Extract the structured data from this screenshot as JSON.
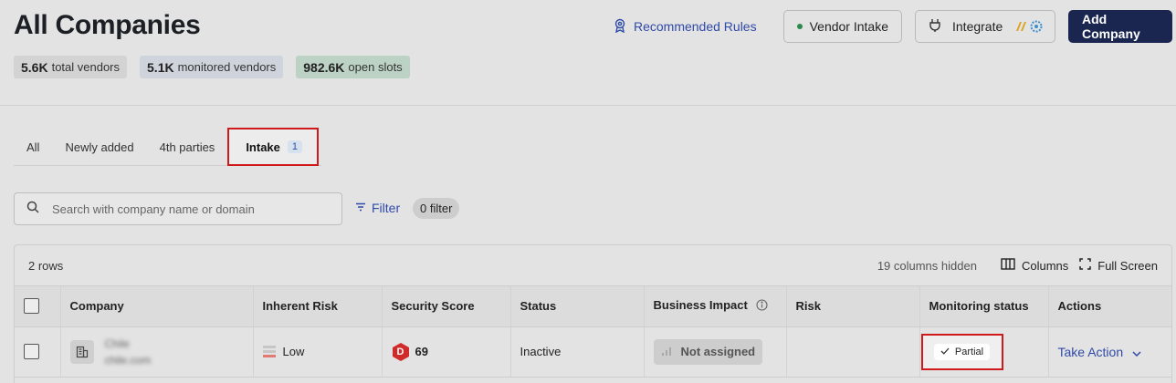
{
  "header": {
    "title": "All Companies",
    "recommended_rules": "Recommended Rules",
    "vendor_intake": "Vendor Intake",
    "integrate": "Integrate",
    "add_company": "Add Company"
  },
  "stats": {
    "total_value": "5.6K",
    "total_label": "total vendors",
    "monitored_value": "5.1K",
    "monitored_label": "monitored vendors",
    "slots_value": "982.6K",
    "slots_label": "open slots"
  },
  "tabs": [
    {
      "label": "All"
    },
    {
      "label": "Newly added"
    },
    {
      "label": "4th parties"
    },
    {
      "label": "Intake",
      "count": "1"
    }
  ],
  "search": {
    "placeholder": "Search with company name or domain"
  },
  "filter": {
    "label": "Filter",
    "count_label": "0 filter"
  },
  "table": {
    "row_count": "2 rows",
    "hidden_columns": "19 columns hidden",
    "columns_button": "Columns",
    "fullscreen_button": "Full Screen",
    "headers": {
      "company": "Company",
      "inherent_risk": "Inherent Risk",
      "security_score": "Security Score",
      "status": "Status",
      "business_impact": "Business Impact",
      "risk": "Risk",
      "monitoring_status": "Monitoring status",
      "actions": "Actions"
    },
    "rows": [
      {
        "company_name": "Chile",
        "company_domain": "chile.com",
        "inherent_risk": "Low",
        "grade": "D",
        "score": "69",
        "status": "Inactive",
        "business_impact": "Not assigned",
        "risk": "",
        "monitoring_status": "Partial",
        "action": "Take Action"
      }
    ]
  },
  "colors": {
    "accent": "#2f4aa8",
    "primary_button": "#1a2550",
    "highlight": "#d0191b",
    "grade_d": "#d02a2a"
  }
}
